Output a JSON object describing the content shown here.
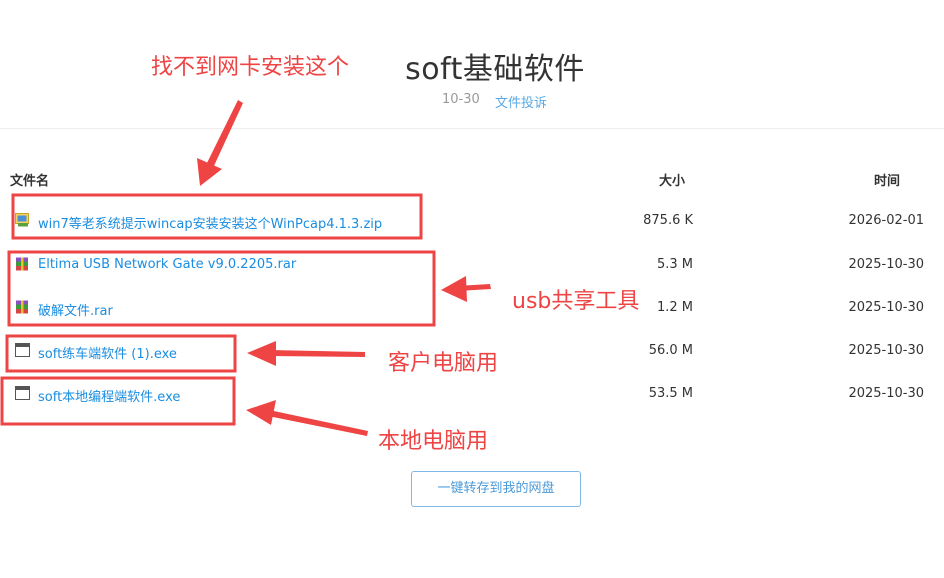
{
  "page": {
    "title": "soft基础软件",
    "date": "10-30",
    "report_link": "文件投诉"
  },
  "table": {
    "headers": {
      "name": "文件名",
      "size": "大小",
      "time": "时间"
    },
    "rows": [
      {
        "icon": "zip-icon",
        "name": "win7等老系统提示wincap安装安装这个WinPcap4.1.3.zip",
        "size": "875.6 K",
        "time": "2026-02-01"
      },
      {
        "icon": "rar-icon",
        "name": "Eltima USB Network Gate v9.0.2205.rar",
        "size": "5.3 M",
        "time": "2025-10-30"
      },
      {
        "icon": "rar-icon",
        "name": "破解文件.rar",
        "size": "1.2 M",
        "time": "2025-10-30"
      },
      {
        "icon": "exe-icon",
        "name": "soft练车端软件 (1).exe",
        "size": "56.0 M",
        "time": "2025-10-30"
      },
      {
        "icon": "exe-icon",
        "name": "soft本地编程端软件.exe",
        "size": "53.5 M",
        "time": "2025-10-30"
      }
    ]
  },
  "save_button": "一键转存到我的网盘",
  "annotations": {
    "no_nic": "找不到网卡安装这个",
    "usb_share": "usb共享工具",
    "client_pc": "客户电脑用",
    "local_pc": "本地电脑用",
    "color": "#ee4444"
  }
}
